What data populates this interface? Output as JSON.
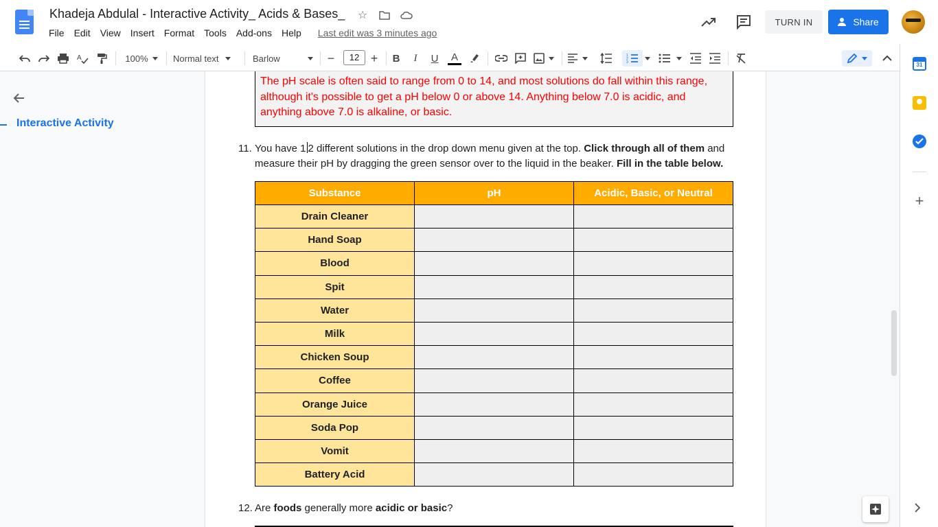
{
  "app": {
    "doc_title": "Khadeja Abdulal - Interactive Activity_ Acids & Bases_",
    "menu": [
      "File",
      "Edit",
      "View",
      "Insert",
      "Format",
      "Tools",
      "Add-ons",
      "Help"
    ],
    "last_edit": "Last edit was 3 minutes ago",
    "turn_in_label": "TURN IN",
    "share_label": "Share"
  },
  "toolbar": {
    "zoom": "100%",
    "style": "Normal text",
    "font": "Barlow",
    "font_size": "12"
  },
  "outline": {
    "item": "Interactive Activity"
  },
  "document": {
    "answer_text": "The pH scale is often said to range from 0 to 14, and most solutions do fall within this range, although it's possible to get a pH below 0 or above 14. Anything below 7.0 is acidic, and anything above 7.0 is alkaline, or basic.",
    "q11": {
      "num": "11.",
      "part1": "You have 1",
      "part2": "2 different solutions in the drop down menu given at the top. ",
      "bold1": "Click through all of them",
      "part3": " and measure their pH by dragging the green sensor over to the liquid in the beaker. ",
      "bold2": "Fill in the table below."
    },
    "table": {
      "headers": [
        "Substance",
        "pH",
        "Acidic, Basic, or Neutral"
      ],
      "rows": [
        "Drain Cleaner",
        "Hand Soap",
        "Blood",
        "Spit",
        "Water",
        "Milk",
        "Chicken Soup",
        "Coffee",
        "Orange Juice",
        "Soda Pop",
        "Vomit",
        "Battery Acid"
      ]
    },
    "q12": {
      "num": "12.",
      "part1": "Are ",
      "bold1": "foods",
      "part2": " generally more ",
      "bold2": "acidic or basic",
      "part3": "?"
    }
  },
  "colors": {
    "header_orange": "#ffab00",
    "substance_yellow": "#ffe599",
    "answer_red": "#ff0000",
    "accent_blue": "#1a73e8"
  }
}
